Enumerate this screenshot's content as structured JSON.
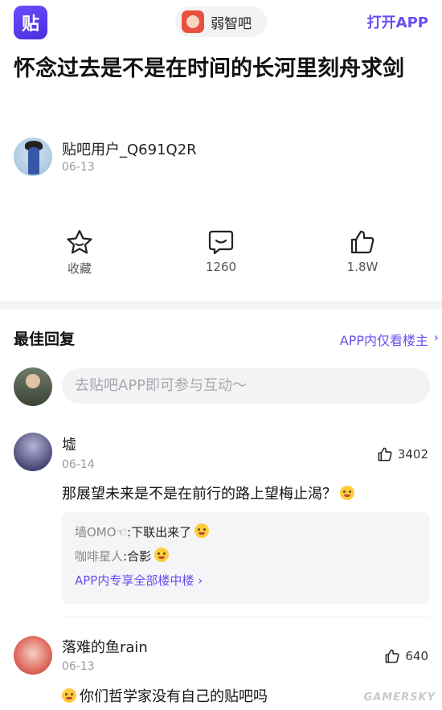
{
  "topbar": {
    "logo_text": "贴",
    "forum_name": "弱智吧",
    "open_app": "打开APP"
  },
  "post": {
    "title": "怀念过去是不是在时间的长河里刻舟求剑",
    "author": "贴吧用户_Q691Q2R",
    "date": "06-13"
  },
  "actions": [
    {
      "label": "收藏",
      "icon": "star-icon"
    },
    {
      "label": "1260",
      "icon": "comment-icon"
    },
    {
      "label": "1.8W",
      "icon": "thumbs-up-icon"
    }
  ],
  "best_replies": {
    "title": "最佳回复",
    "only_op": "APP内仅看楼主",
    "comment_placeholder": "去贴吧APP即可参与互动～"
  },
  "replies": [
    {
      "name": "墟",
      "date": "06-14",
      "likes": "3402",
      "text": "那展望未来是不是在前行的路上望梅止渴？",
      "subreplies": [
        {
          "user": "墙OMO☜",
          "text": ":下联出来了"
        },
        {
          "user": "咖啡星人",
          "text": ":合影"
        }
      ],
      "more": "APP内专享全部楼中楼 ›"
    },
    {
      "name": "落难的鱼rain",
      "date": "06-13",
      "likes": "640",
      "text": "你们哲学家没有自己的贴吧吗"
    }
  ],
  "watermark": "GAMERSKY",
  "colors": {
    "accent": "#6b4cf0",
    "separator": "#f4f4f6"
  }
}
